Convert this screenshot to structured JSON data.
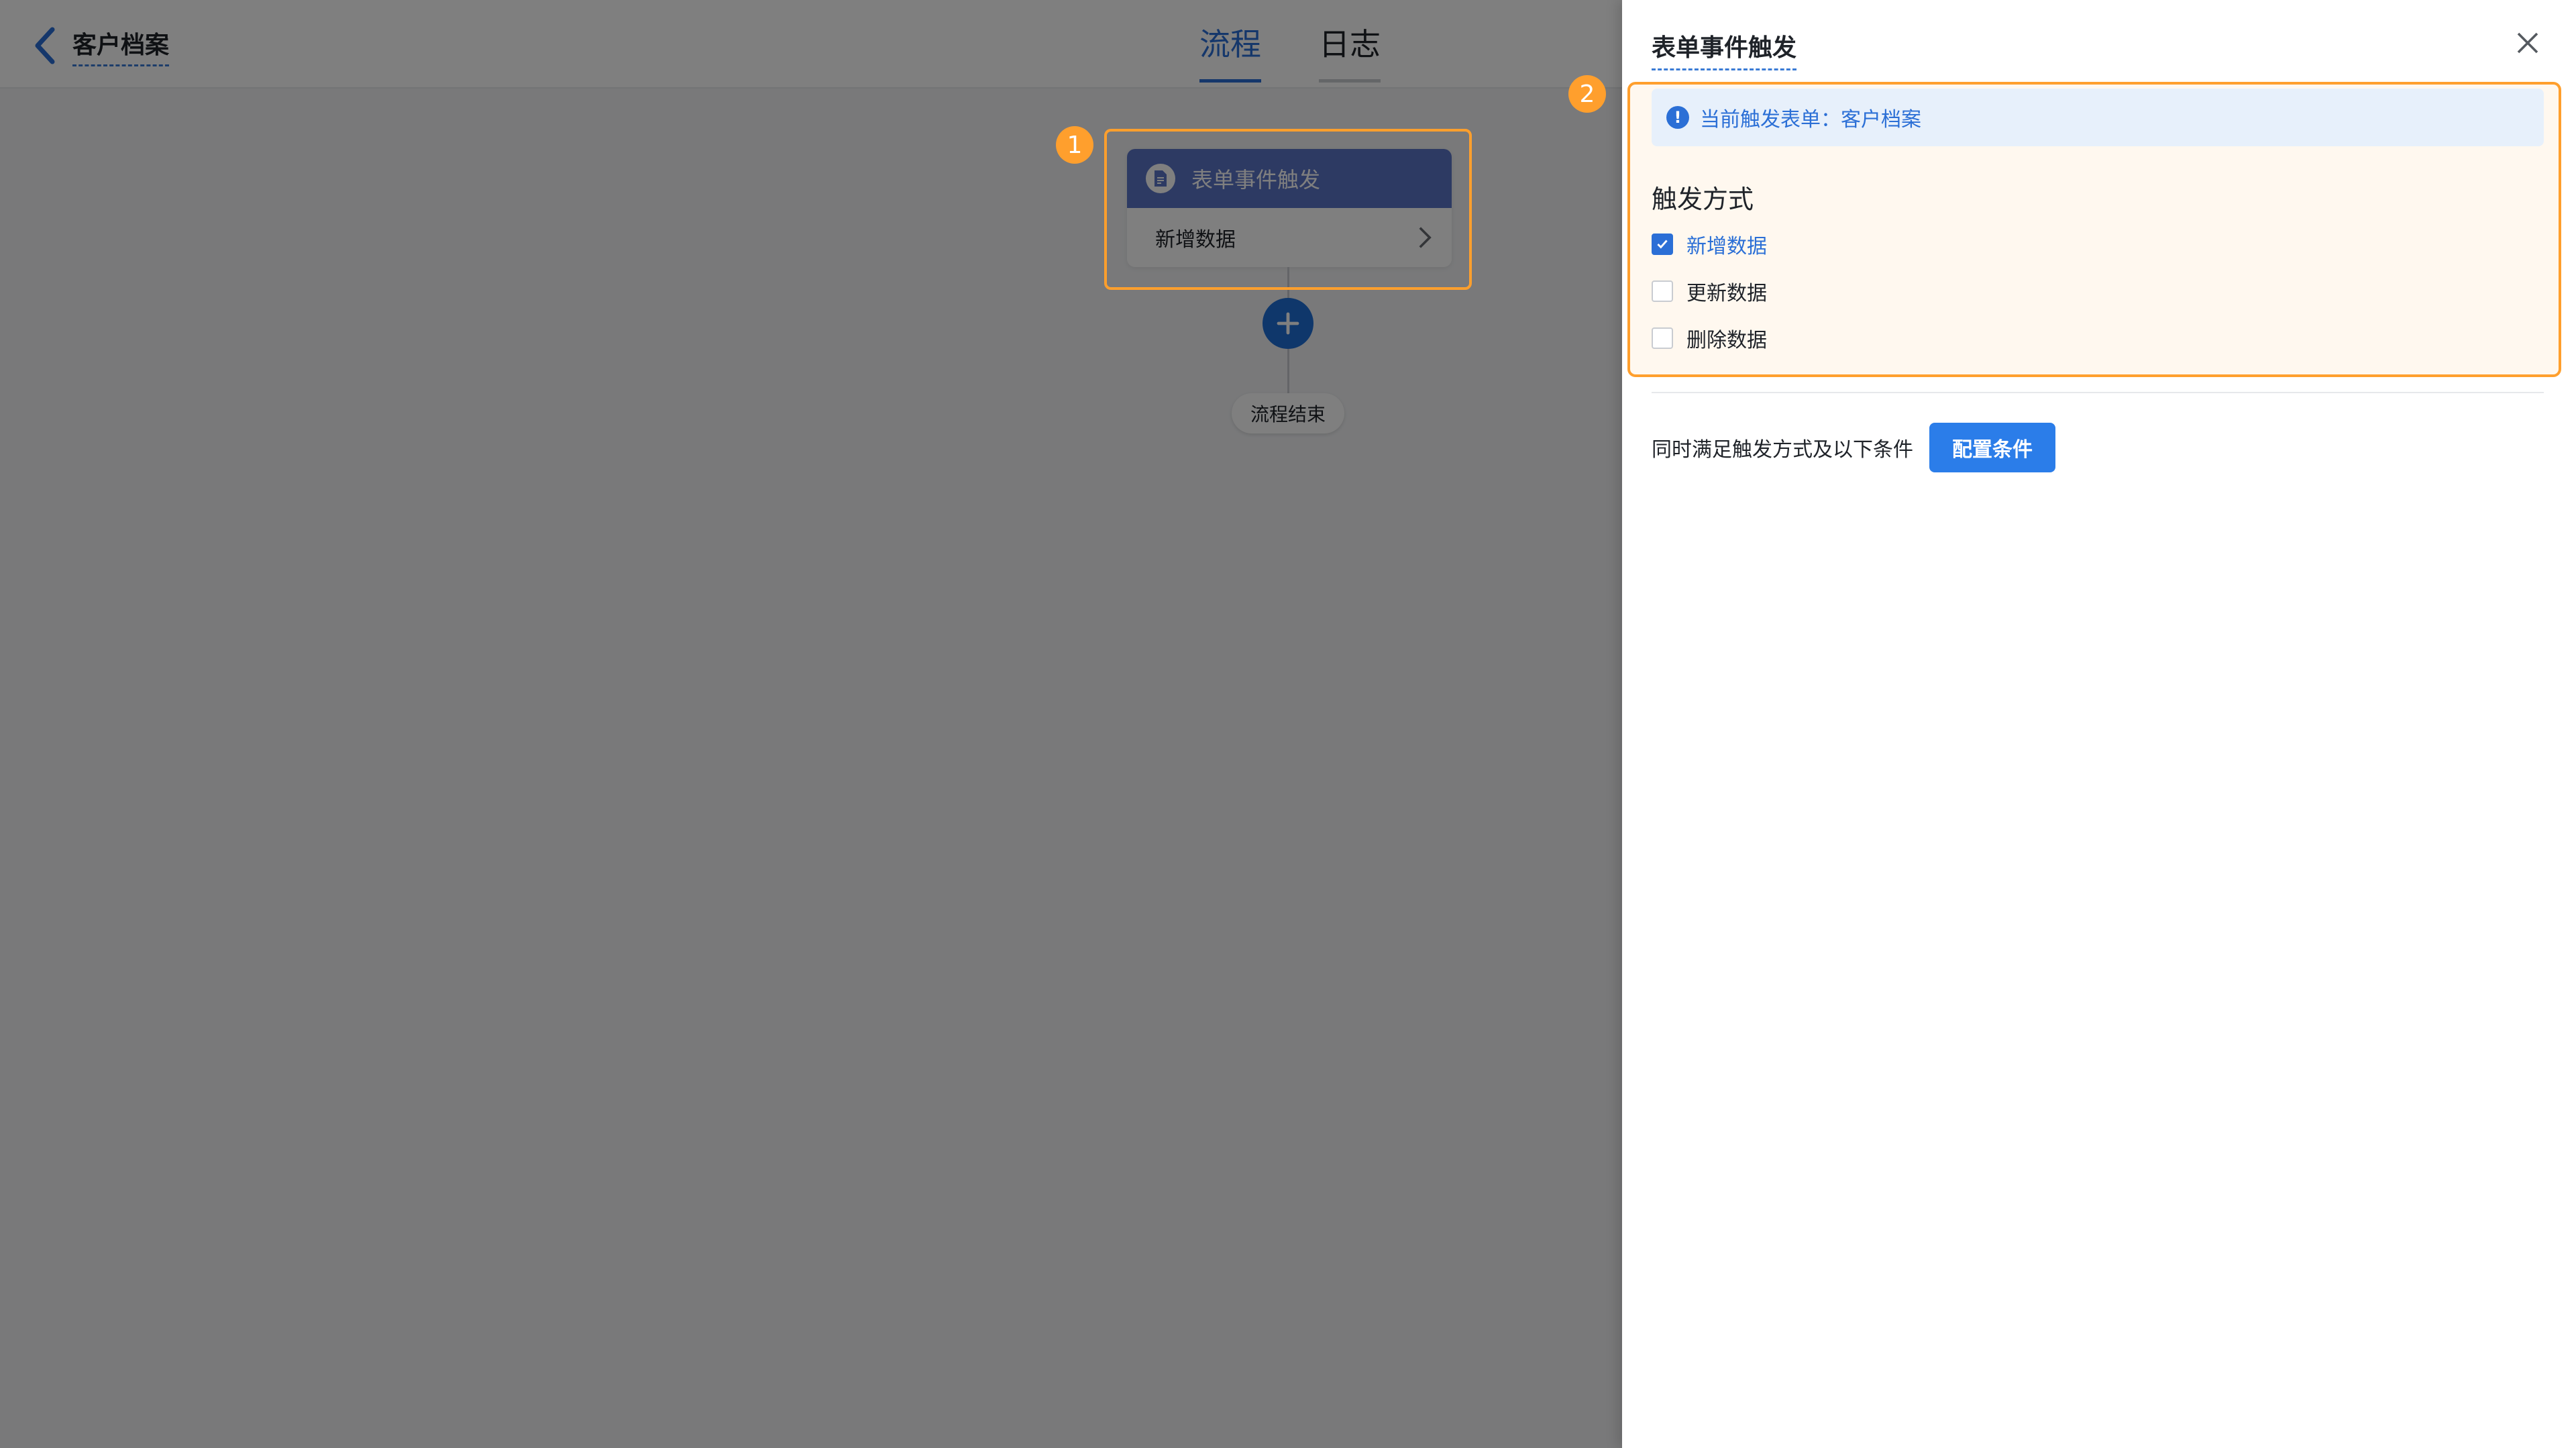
{
  "header": {
    "back_title": "客户档案",
    "tabs": [
      {
        "label": "流程",
        "active": true
      },
      {
        "label": "日志",
        "active": false
      }
    ]
  },
  "flow": {
    "node_title": "表单事件触发",
    "node_value": "新增数据",
    "end_label": "流程结束"
  },
  "markers": {
    "one": "1",
    "two": "2"
  },
  "drawer": {
    "title": "表单事件触发",
    "info_text": "当前触发表单：客户档案",
    "trigger_label": "触发方式",
    "options": [
      {
        "label": "新增数据",
        "checked": true
      },
      {
        "label": "更新数据",
        "checked": false
      },
      {
        "label": "删除数据",
        "checked": false
      }
    ],
    "condition_text": "同时满足触发方式及以下条件",
    "condition_button": "配置条件"
  },
  "colors": {
    "accent": "#2b6fd6",
    "highlight": "#ff9f2d",
    "node_header": "#5b74c7"
  }
}
